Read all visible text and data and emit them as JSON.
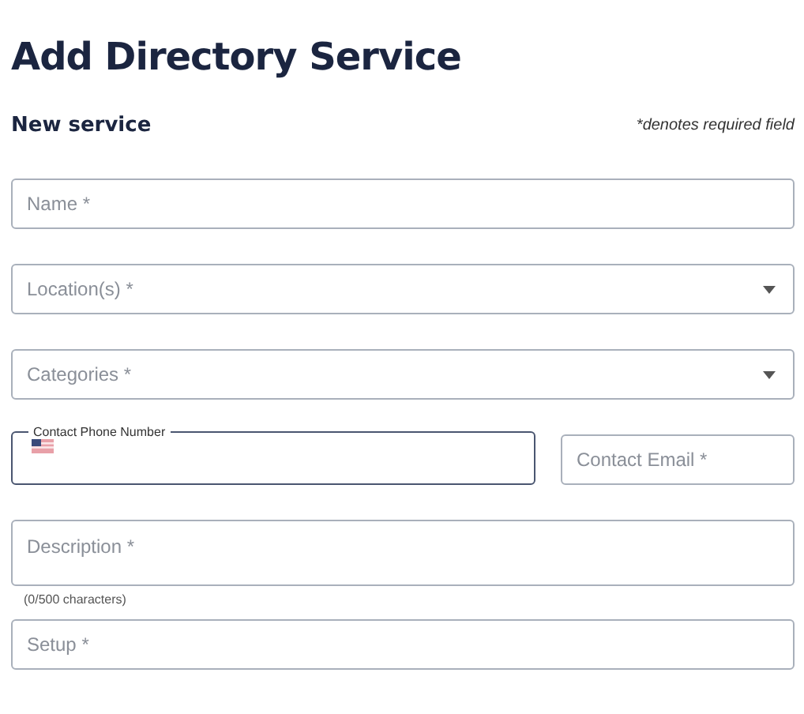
{
  "title": "Add Directory Service",
  "section": {
    "title": "New service",
    "note": "*denotes required field"
  },
  "rows": [
    {
      "fields": [
        {
          "kind": "text",
          "placeholder": "Name *"
        }
      ]
    },
    {
      "fields": [
        {
          "kind": "select",
          "placeholder": "Location(s) *"
        }
      ]
    },
    {
      "fields": [
        {
          "kind": "select",
          "placeholder": "Categories *"
        }
      ]
    },
    {
      "fields": [
        {
          "kind": "phone",
          "label": "Contact Phone Number",
          "focused": true
        },
        {
          "kind": "text",
          "placeholder": "Contact Email *"
        }
      ]
    },
    {
      "fields": [
        {
          "kind": "textarea",
          "placeholder": "Description *",
          "helper": "(0/500 characters)"
        }
      ]
    },
    {
      "fields": [
        {
          "kind": "text",
          "placeholder": "Setup *"
        }
      ]
    }
  ]
}
